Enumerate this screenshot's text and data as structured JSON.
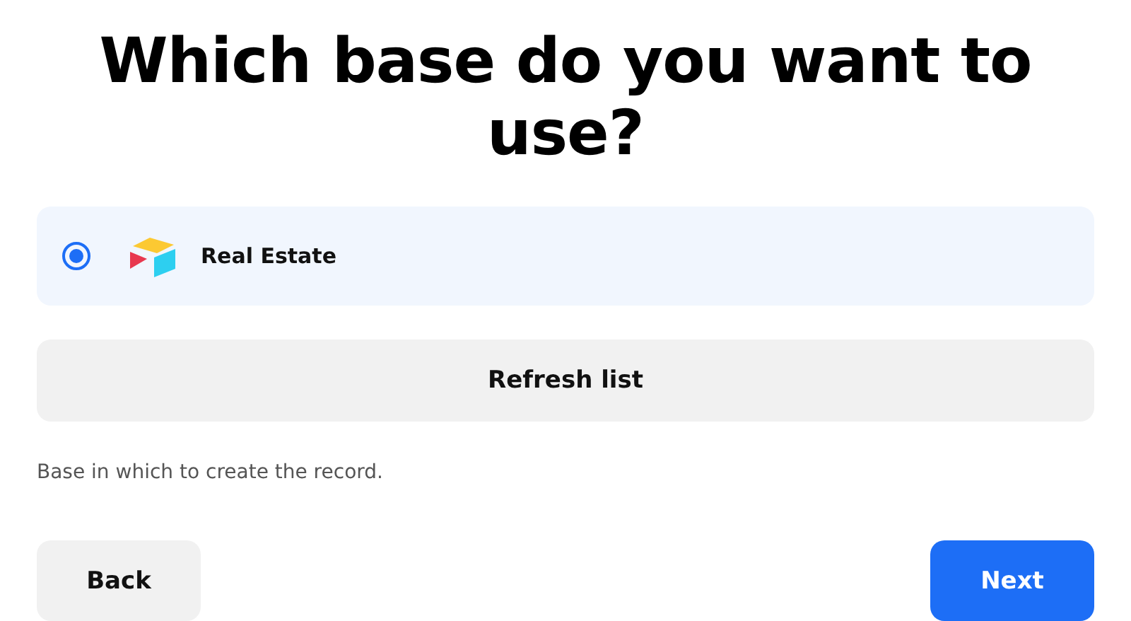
{
  "title": "Which base do you want to use?",
  "options": [
    {
      "label": "Real Estate",
      "selected": true
    }
  ],
  "refresh_button": "Refresh list",
  "help_text": "Base in which to create the record.",
  "buttons": [
    {
      "label": "Back",
      "kind": "secondary"
    },
    {
      "label": "Next",
      "kind": "primary"
    }
  ]
}
